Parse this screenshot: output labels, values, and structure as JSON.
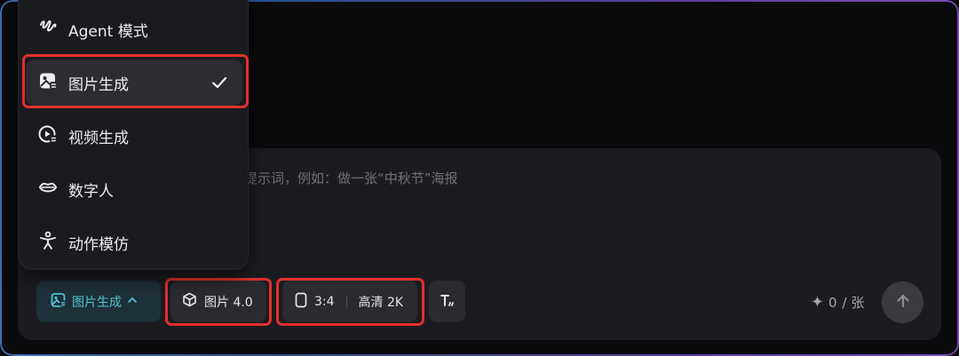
{
  "prompt": {
    "placeholder": "的提示词，例如：做一张“中秋节”海报"
  },
  "menu": {
    "items": [
      {
        "label": "Agent 模式",
        "icon": "agent-wave-icon"
      },
      {
        "label": "图片生成",
        "icon": "image-gen-icon",
        "selected": true
      },
      {
        "label": "视频生成",
        "icon": "video-gen-icon"
      },
      {
        "label": "数字人",
        "icon": "lips-icon"
      },
      {
        "label": "动作模仿",
        "icon": "motion-figure-icon"
      }
    ]
  },
  "toolbar": {
    "mode_label": "图片生成",
    "model_label": "图片 4.0",
    "ratio_label": "3:4",
    "quality_label": "高清 2K",
    "credits_value": "0",
    "credits_unit": "/ 张"
  },
  "colors": {
    "accent": "#4fc3d6",
    "highlight": "#e2302c",
    "menu_bg": "#1a1b1f",
    "composer_bg": "#1c1c20"
  }
}
